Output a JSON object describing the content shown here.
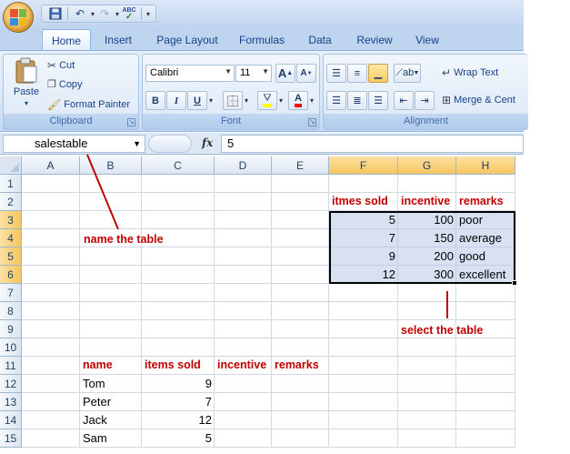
{
  "quick_access": {
    "undo_icon": "undo-icon",
    "redo_icon": "redo-icon",
    "spelling_icon": "spelling-icon",
    "spelling_label": "ABC"
  },
  "tabs": [
    {
      "label": "Home",
      "active": true
    },
    {
      "label": "Insert"
    },
    {
      "label": "Page Layout"
    },
    {
      "label": "Formulas"
    },
    {
      "label": "Data"
    },
    {
      "label": "Review"
    },
    {
      "label": "View"
    }
  ],
  "ribbon": {
    "clipboard": {
      "label": "Clipboard",
      "paste": "Paste",
      "cut": "Cut",
      "copy": "Copy",
      "format_painter": "Format Painter"
    },
    "font": {
      "label": "Font",
      "font_name": "Calibri",
      "font_size": "11",
      "grow": "A",
      "shrink": "A",
      "bold": "B",
      "italic": "I",
      "underline": "U",
      "font_color_letter": "A"
    },
    "alignment": {
      "label": "Alignment",
      "wrap_text": "Wrap Text",
      "merge_center": "Merge & Cent"
    }
  },
  "formula_bar": {
    "name_box": "salestable",
    "fx": "fx",
    "value": "5"
  },
  "columns": [
    "A",
    "B",
    "C",
    "D",
    "E",
    "F",
    "G",
    "H"
  ],
  "rows": [
    "1",
    "2",
    "3",
    "4",
    "5",
    "6",
    "7",
    "8",
    "9",
    "10",
    "11",
    "12",
    "13",
    "14",
    "15"
  ],
  "cells": {
    "F2": "itmes sold",
    "G2": "incentive",
    "H2": "remarks",
    "F3": "5",
    "G3": "100",
    "H3": "poor",
    "F4": "7",
    "G4": "150",
    "H4": "average",
    "F5": "9",
    "G5": "200",
    "H5": "good",
    "F6": "12",
    "G6": "300",
    "H6": "excellent",
    "B11": "name",
    "C11": "items sold",
    "D11": "incentive",
    "E11": "remarks",
    "B12": "Tom",
    "C12": "9",
    "B13": "Peter",
    "C13": "7",
    "B14": "Jack",
    "C14": "12",
    "B15": "Sam",
    "C15": "5"
  },
  "annotations": {
    "name_table": "name the table",
    "select_table": "select the table"
  },
  "colors": {
    "annotation": "#c00000",
    "selection_fill": "#b8c9e6",
    "header_selected": "#f6c560"
  }
}
